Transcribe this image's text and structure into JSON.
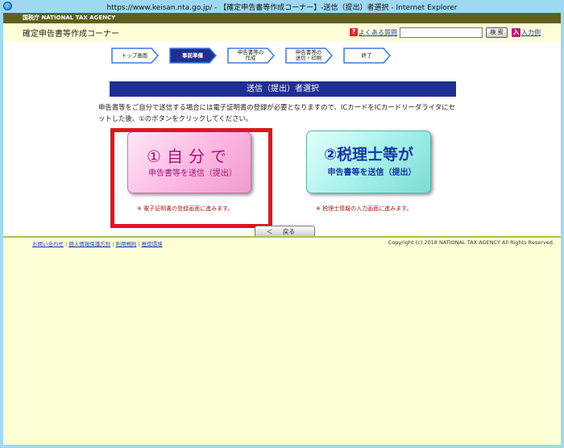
{
  "window": {
    "title": "https://www.keisan.nta.go.jp/ - 【確定申告書等作成コーナー】-送信（提出）者選択 - Internet Explorer"
  },
  "agency": {
    "name": "国税庁 NATIONAL TAX AGENCY"
  },
  "header": {
    "corner_title": "確定申告書等作成コーナー",
    "faq_icon": "?",
    "faq_label": "よくある質問",
    "search_value": "",
    "search_button": "検 索",
    "entry_icon": "入",
    "entry_label": "入力例"
  },
  "steps": [
    {
      "label": "トップ画面",
      "active": false
    },
    {
      "label": "事前準備",
      "active": true
    },
    {
      "label": "申告書等の\n作成",
      "active": false
    },
    {
      "label": "申告書等の\n送信・印刷",
      "active": false
    },
    {
      "label": "終了",
      "active": false
    }
  ],
  "section": {
    "heading": "送信（提出）者選択",
    "instruction": "申告書等をご自分で送信する場合には電子証明書の登録が必要となりますので、ICカードをICカードリーダライタにセットした後、①のボタンをクリックしてください。"
  },
  "choices": {
    "self": {
      "main": "①自分で",
      "sub": "申告書等を送信（提出）",
      "note": "※ 電子証明書の登録画面に進みます。"
    },
    "tax_accountant": {
      "main": "②税理士等が",
      "sub": "申告書等を送信（提出）",
      "note": "※ 税理士情報の入力画面に進みます。"
    }
  },
  "back_button": {
    "arrow": "＜",
    "label": "戻る"
  },
  "footer": {
    "links": [
      "お問い合わせ",
      "個人情報保護方針",
      "利用規約",
      "推奨環境"
    ],
    "copyright": "Copyright (c) 2018 NATIONAL TAX AGENCY All Rights Reserved."
  },
  "colors": {
    "agency_bar": "#60601c",
    "heading": "#1f2f93",
    "active_step": "#1f2f93",
    "step_border": "#3d7bd8",
    "highlight": "#e0141c",
    "self_text": "#a7127a",
    "tax_text": "#1736a8"
  }
}
